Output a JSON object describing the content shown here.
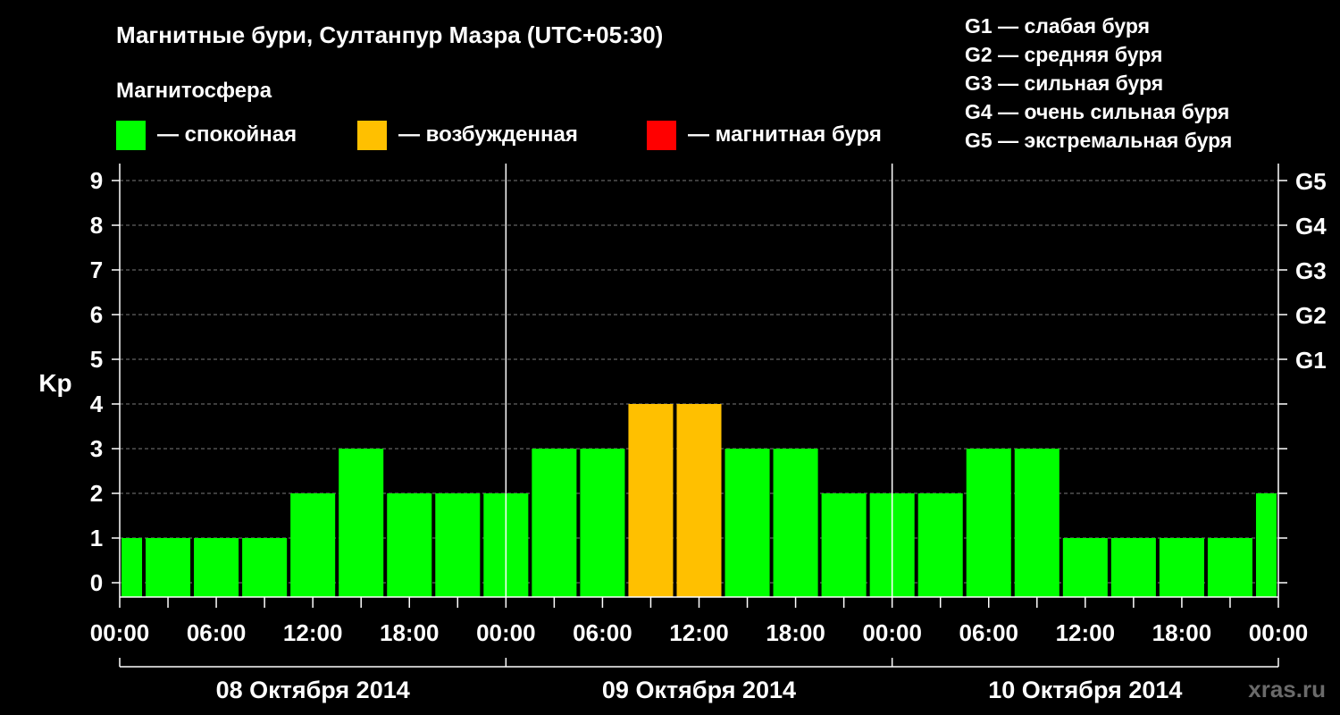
{
  "title": "Магнитные бури, Султанпур Мазра (UTC+05:30)",
  "subtitle": "Магнитосфера",
  "legend": [
    {
      "name": "spokoynaya",
      "label": "— спокойная",
      "color": "#00ff00"
    },
    {
      "name": "vozbuzhdennaya",
      "label": "— возбужденная",
      "color": "#ffc000"
    },
    {
      "name": "magnitnaya-burya",
      "label": "— магнитная буря",
      "color": "#ff0000"
    }
  ],
  "g_scale": [
    "G1 — слабая буря",
    "G2 — средняя буря",
    "G3 — сильная буря",
    "G4 — очень сильная буря",
    "G5 — экстремальная буря"
  ],
  "watermark": "xras.ru",
  "chart_data": {
    "type": "bar",
    "ylabel": "Kp",
    "ylim": [
      0,
      9
    ],
    "y_ticks": [
      "0",
      "1",
      "2",
      "3",
      "4",
      "5",
      "6",
      "7",
      "8",
      "9"
    ],
    "right_labels": [
      {
        "level": 5,
        "label": "G1"
      },
      {
        "level": 6,
        "label": "G2"
      },
      {
        "level": 7,
        "label": "G3"
      },
      {
        "level": 8,
        "label": "G4"
      },
      {
        "level": 9,
        "label": "G5"
      }
    ],
    "grid": "dashed horizontal",
    "x_tick_labels": [
      "00:00",
      "06:00",
      "12:00",
      "18:00",
      "00:00",
      "06:00",
      "12:00",
      "18:00",
      "00:00",
      "06:00",
      "12:00",
      "18:00",
      "00:00"
    ],
    "days": [
      "08 Октября 2014",
      "09 Октября 2014",
      "10 Октября 2014"
    ],
    "bar_interval_hours": 3,
    "values": [
      1,
      1,
      1,
      1,
      2,
      3,
      2,
      2,
      2,
      3,
      3,
      4,
      4,
      3,
      3,
      2,
      2,
      2,
      3,
      3,
      1,
      1,
      1,
      1,
      2
    ],
    "colors": {
      "quiet": "#00ff00",
      "active": "#ffc000",
      "storm": "#ff0000"
    }
  }
}
